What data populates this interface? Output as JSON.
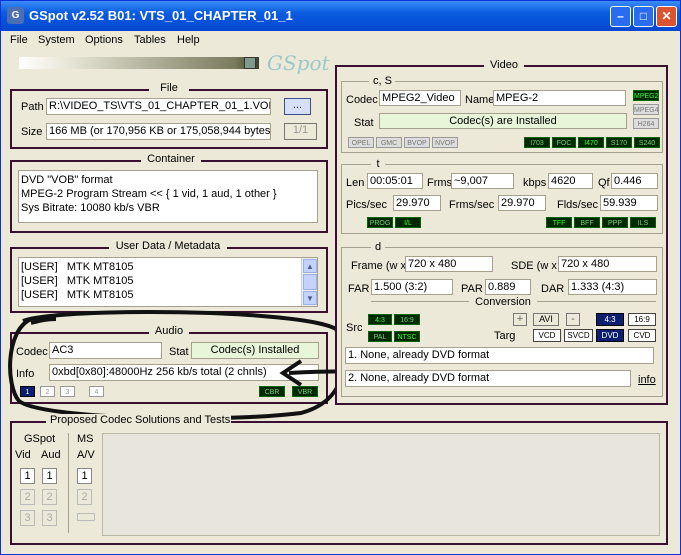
{
  "window": {
    "title": "GSpot v2.52 B01: VTS_01_CHAPTER_01_1"
  },
  "menu": [
    "File",
    "System",
    "Options",
    "Tables",
    "Help"
  ],
  "logo": "GSpot",
  "file": {
    "legend": "File",
    "path_label": "Path",
    "path_value": "R:\\VIDEO_TS\\VTS_01_CHAPTER_01_1.VOB",
    "browse": "...",
    "size_label": "Size",
    "size_value": "166 MB (or 170,956 KB or 175,058,944 bytes)",
    "page": "1/1"
  },
  "container": {
    "legend": "Container",
    "lines": [
      "DVD \"VOB\" format",
      "MPEG-2 Program Stream << { 1 vid, 1 aud, 1 other }",
      "Sys Bitrate: 10080 kb/s VBR"
    ]
  },
  "userdata": {
    "legend": "User Data / Metadata",
    "rows": [
      {
        "tag": "[USER]",
        "val": "MTK MT8105"
      },
      {
        "tag": "[USER]",
        "val": "MTK MT8105"
      },
      {
        "tag": "[USER]",
        "val": "MTK MT8105"
      }
    ]
  },
  "audio": {
    "legend": "Audio",
    "codec_label": "Codec",
    "codec_value": "AC3",
    "stat_label": "Stat",
    "stat_value": "Codec(s) Installed",
    "info_label": "Info",
    "info_value": "0xbd[0x80]:48000Hz  256 kb/s total (2 chnls)",
    "tracks": [
      "1",
      "2",
      "3",
      "4"
    ],
    "cbr": "CBR",
    "vbr": "VBR"
  },
  "video": {
    "legend": "Video",
    "cs_legend": "c, S",
    "codec_label": "Codec",
    "codec_value": "MPEG2_Video",
    "name_label": "Name",
    "name_value": "MPEG-2",
    "stat_label": "Stat",
    "stat_value": "Codec(s) are Installed",
    "mpeg_leds": [
      "MPEG2",
      "MPEG4",
      "H264"
    ],
    "flag_leds_left": [
      "OPEL",
      "GMC",
      "BVOP",
      "NVOP"
    ],
    "flag_leds_right": [
      "I703",
      "FOC",
      "I470",
      "S170",
      "S240"
    ],
    "t_legend": "t",
    "len_label": "Len",
    "len_value": "00:05:01",
    "frms_label": "Frms",
    "frms_value": "~9,007",
    "kbps_label": "kbps",
    "kbps_value": "4620",
    "qf_label": "Qf",
    "qf_value": "0.446",
    "pics_label": "Pics/sec",
    "pics_value": "29.970",
    "frmsec_label": "Frms/sec",
    "frmsec_value": "29.970",
    "flds_label": "Flds/sec",
    "flds_value": "59.939",
    "t_leds_left": [
      "PROG",
      "I/L"
    ],
    "t_leds_right": [
      "TFF",
      "BFF",
      "PPP",
      "ILS"
    ],
    "d_legend": "d",
    "frame_label": "Frame (w x",
    "frame_value": "720 x 480",
    "sde_label": "SDE (w x",
    "sde_value": "720 x 480",
    "far_label": "FAR",
    "far_value": "1.500 (3:2)",
    "par_label": "PAR",
    "par_value": "0.889",
    "dar_label": "DAR",
    "dar_value": "1.333 (4:3)",
    "conversion": "Conversion",
    "src_label": "Src",
    "src_leds": [
      "4:3",
      "16:9",
      "PAL",
      "NTSC"
    ],
    "targ_label": "Targ",
    "plus": "+",
    "avi": "AVI",
    "minus": "-",
    "targ_top": [
      "4:3",
      "16:9"
    ],
    "targ_bottom": [
      "VCD",
      "SVCD",
      "DVD",
      "CVD"
    ],
    "line1": "1. None, already DVD format",
    "line2": "2. None, already DVD format",
    "info": "info"
  },
  "proposed": {
    "legend": "Proposed Codec Solutions and Tests",
    "gspot": "GSpot",
    "ms": "MS",
    "vid": "Vid",
    "aud": "Aud",
    "av": "A/V",
    "nums": [
      "1",
      "2",
      "3"
    ]
  }
}
